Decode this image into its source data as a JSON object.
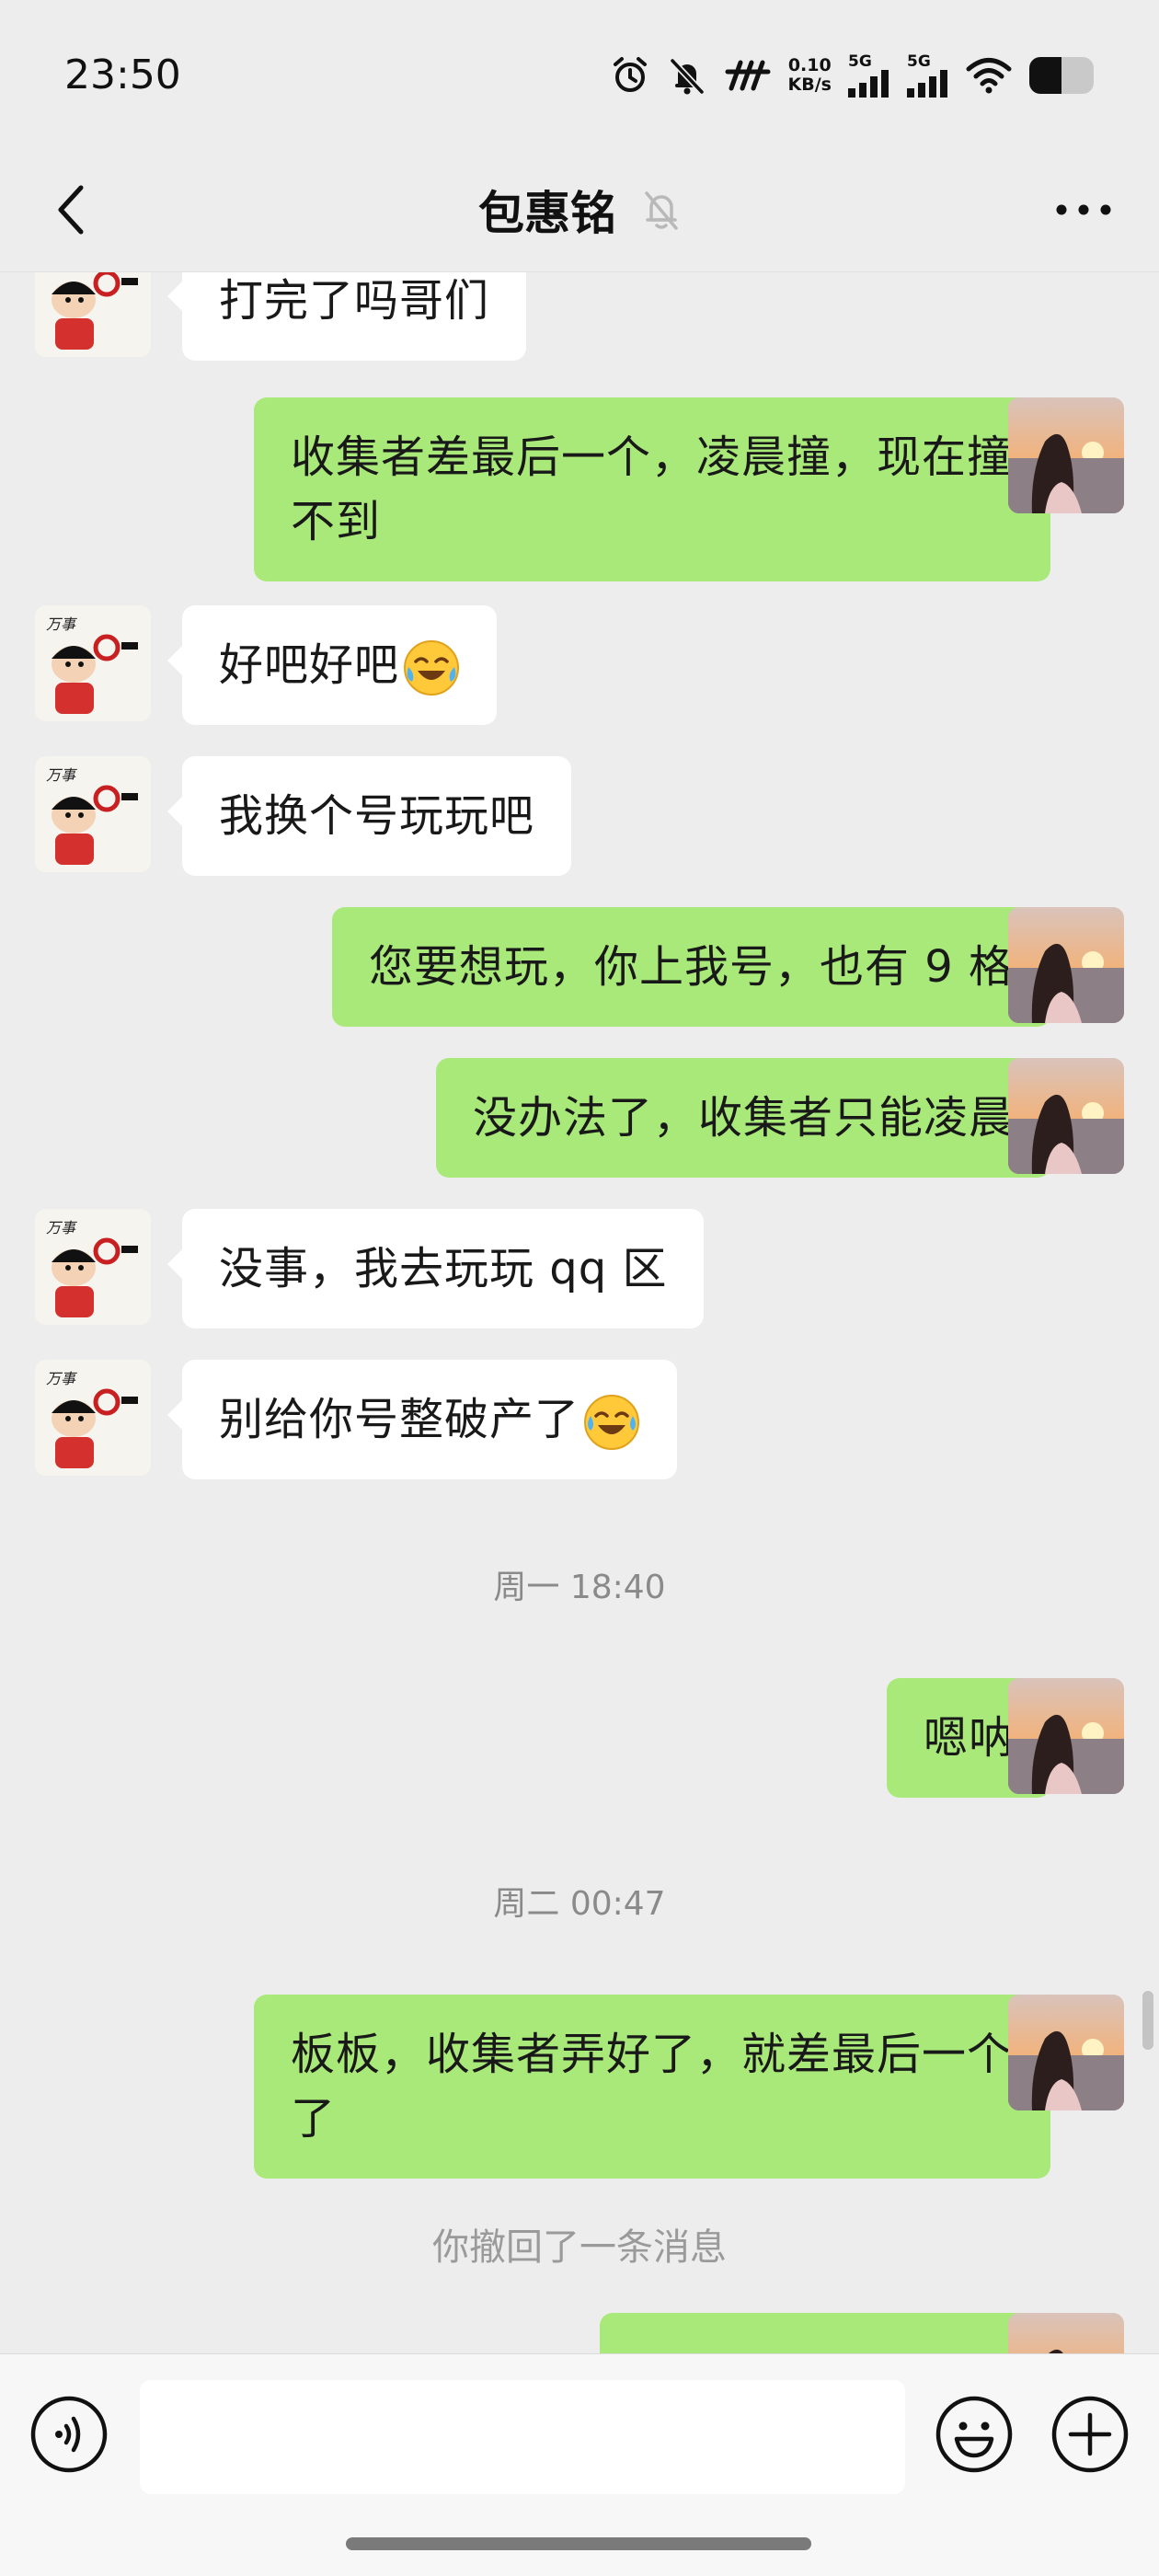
{
  "status_bar": {
    "time": "23:50",
    "net_speed_value": "0.10",
    "net_speed_unit": "KB/s",
    "sim1_label": "5G",
    "sim2_label": "5G",
    "icons": [
      "alarm-icon",
      "mute-bell-icon",
      "carrier-logo-icon",
      "signal-icon",
      "signal-icon",
      "wifi-icon",
      "battery-icon"
    ]
  },
  "header": {
    "title": "包惠铭",
    "icons": [
      "back-arrow-icon",
      "mute-icon",
      "more-icon"
    ]
  },
  "messages": [
    {
      "side": "left",
      "text": "打完了吗哥们"
    },
    {
      "side": "right",
      "text": "收集者差最后一个，凌晨撞，现在撞不到"
    },
    {
      "side": "left",
      "text": "好吧好吧",
      "emoji": "laughing-crying-emoji"
    },
    {
      "side": "left",
      "text": "我换个号玩玩吧"
    },
    {
      "side": "right",
      "text": "您要想玩，你上我号，也有 9 格"
    },
    {
      "side": "right",
      "text": "没办法了，收集者只能凌晨"
    },
    {
      "side": "left",
      "text": "没事，我去玩玩 qq 区"
    },
    {
      "side": "left",
      "text": "别给你号整破产了",
      "emoji": "tears-of-joy-emoji"
    },
    {
      "type": "time",
      "text": "周一 18:40"
    },
    {
      "side": "right",
      "text": "嗯呐"
    },
    {
      "type": "time",
      "text": "周二 00:47"
    },
    {
      "side": "right",
      "text": "板板，收集者弄好了，就差最后一个了"
    },
    {
      "type": "system",
      "text": "你撤回了一条消息"
    }
  ],
  "input_bar": {
    "input_value": "",
    "icons": [
      "voice-icon",
      "emoji-icon",
      "plus-icon"
    ]
  },
  "colors": {
    "background": "#ededed",
    "bubble_sent": "#a9e97a",
    "bubble_received": "#ffffff",
    "timestamp": "#8a8a8a"
  }
}
